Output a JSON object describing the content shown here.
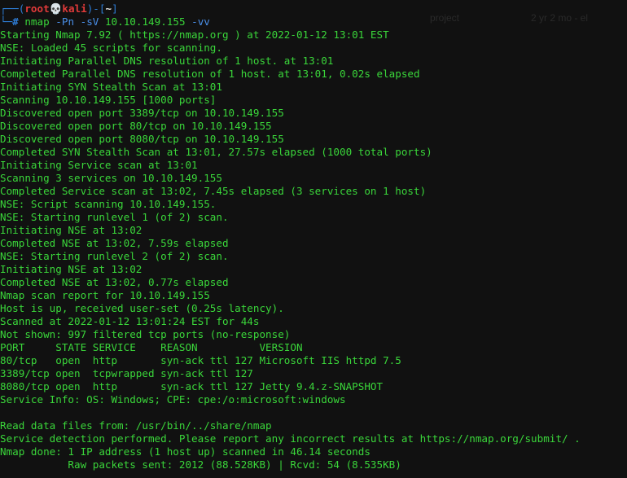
{
  "prompt": {
    "frame_top": "┌──(",
    "user": "root",
    "skull": "💀",
    "host": "kali",
    "sep": ")-[",
    "path": "~",
    "end": "]",
    "frame_bottom": "└─",
    "hash": "# ",
    "command": "nmap",
    "flags": [
      "-Pn",
      "-sV"
    ],
    "target": "10.10.149.155",
    "verbose": "-vv"
  },
  "output_lines": [
    "Starting Nmap 7.92 ( https://nmap.org ) at 2022-01-12 13:01 EST",
    "NSE: Loaded 45 scripts for scanning.",
    "Initiating Parallel DNS resolution of 1 host. at 13:01",
    "Completed Parallel DNS resolution of 1 host. at 13:01, 0.02s elapsed",
    "Initiating SYN Stealth Scan at 13:01",
    "Scanning 10.10.149.155 [1000 ports]",
    "Discovered open port 3389/tcp on 10.10.149.155",
    "Discovered open port 80/tcp on 10.10.149.155",
    "Discovered open port 8080/tcp on 10.10.149.155",
    "Completed SYN Stealth Scan at 13:01, 27.57s elapsed (1000 total ports)",
    "Initiating Service scan at 13:01",
    "Scanning 3 services on 10.10.149.155",
    "Completed Service scan at 13:02, 7.45s elapsed (3 services on 1 host)",
    "NSE: Script scanning 10.10.149.155.",
    "NSE: Starting runlevel 1 (of 2) scan.",
    "Initiating NSE at 13:02",
    "Completed NSE at 13:02, 7.59s elapsed",
    "NSE: Starting runlevel 2 (of 2) scan.",
    "Initiating NSE at 13:02",
    "Completed NSE at 13:02, 0.77s elapsed",
    "Nmap scan report for 10.10.149.155",
    "Host is up, received user-set (0.25s latency).",
    "Scanned at 2022-01-12 13:01:24 EST for 44s",
    "Not shown: 997 filtered tcp ports (no-response)",
    "PORT     STATE SERVICE    REASON          VERSION",
    "80/tcp   open  http       syn-ack ttl 127 Microsoft IIS httpd 7.5",
    "3389/tcp open  tcpwrapped syn-ack ttl 127",
    "8080/tcp open  http       syn-ack ttl 127 Jetty 9.4.z-SNAPSHOT",
    "Service Info: OS: Windows; CPE: cpe:/o:microsoft:windows",
    "",
    "Read data files from: /usr/bin/../share/nmap",
    "Service detection performed. Please report any incorrect results at https://nmap.org/submit/ .",
    "Nmap done: 1 IP address (1 host up) scanned in 46.14 seconds",
    "           Raw packets sent: 2012 (88.528KB) | Rcvd: 54 (8.535KB)"
  ],
  "background_ghost": {
    "text_a": "project",
    "text_b": "2 yr 2 mo - el"
  },
  "colors": {
    "background": "#111111",
    "output_text": "#3ad63a",
    "frame": "#2f7dd6",
    "user": "#e23a3a",
    "flag": "#4a8fe8"
  }
}
